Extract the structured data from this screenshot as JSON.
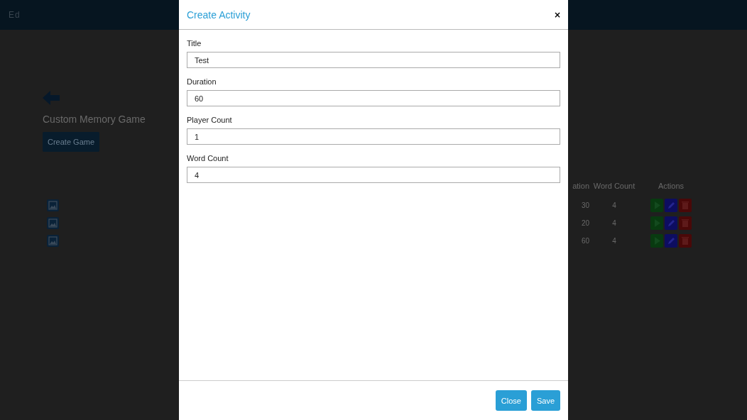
{
  "header": {
    "logo": "Ed"
  },
  "page": {
    "title": "Custom Memory Game",
    "create_button": "Create Game"
  },
  "table": {
    "columns": [
      "ation",
      "Word Count",
      "Actions"
    ],
    "rows": [
      {
        "duration": "30",
        "word_count": "4"
      },
      {
        "duration": "20",
        "word_count": "4"
      },
      {
        "duration": "60",
        "word_count": "4"
      }
    ]
  },
  "modal": {
    "title": "Create Activity",
    "close_icon": "×",
    "fields": [
      {
        "label": "Title",
        "value": "Test"
      },
      {
        "label": "Duration",
        "value": "60"
      },
      {
        "label": "Player Count",
        "value": "1"
      },
      {
        "label": "Word Count",
        "value": "4"
      }
    ],
    "buttons": [
      "Close",
      "Save"
    ]
  }
}
